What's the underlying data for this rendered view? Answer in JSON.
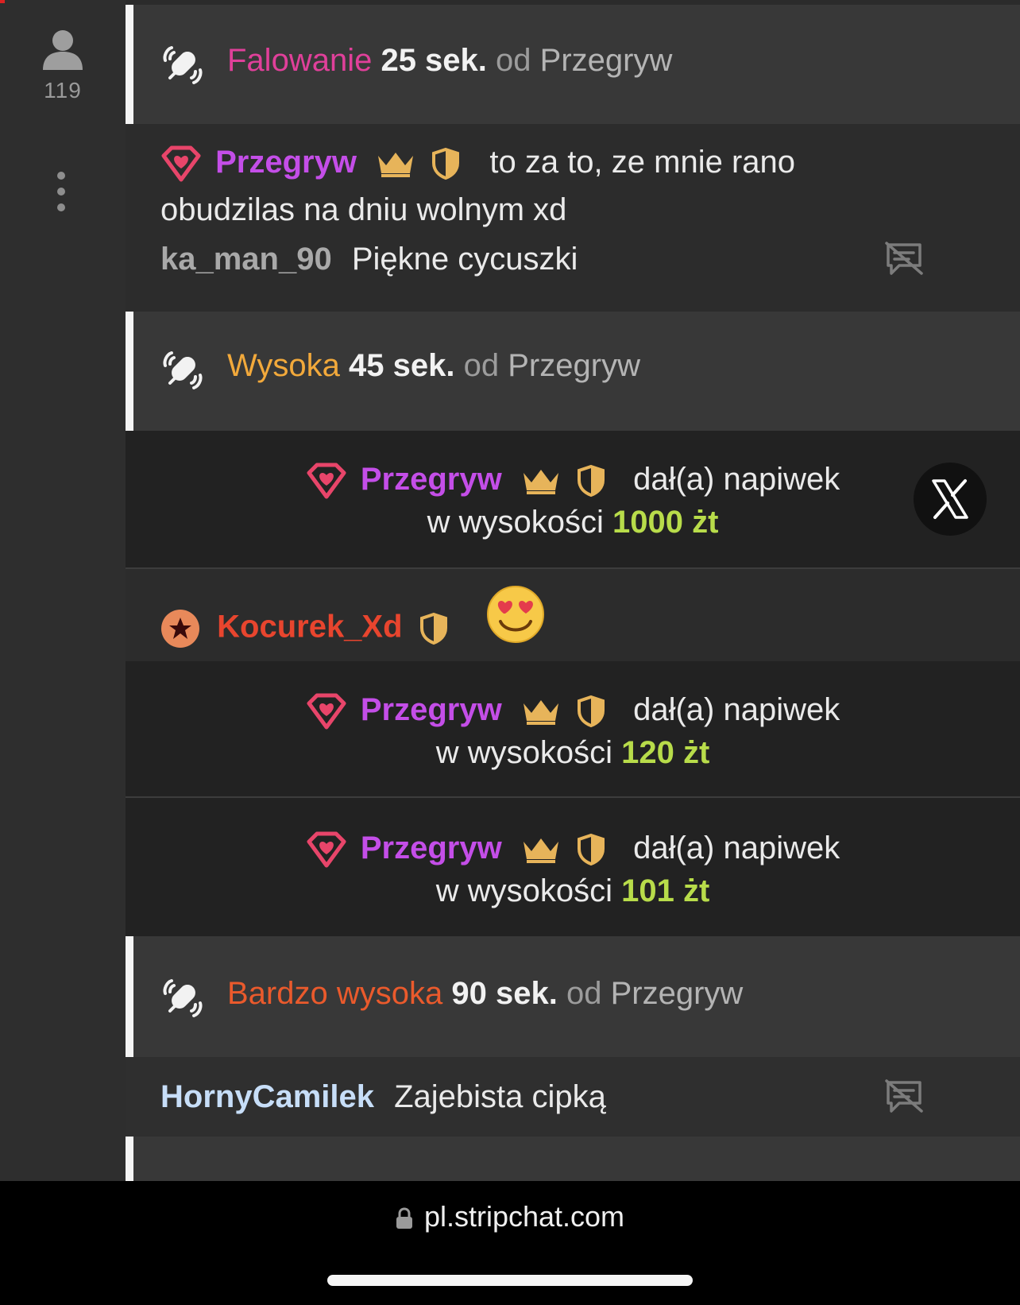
{
  "sidebar": {
    "viewer_count": "119",
    "icons": [
      "user-icon",
      "more-vertical-icon"
    ]
  },
  "vibrations": [
    {
      "level": "Falowanie",
      "level_color": "#e0409a",
      "duration": "25 sek.",
      "from_word": "od",
      "from_user": "Przegryw"
    },
    {
      "level": "Wysoka",
      "level_color": "#f2a93b",
      "duration": "45 sek.",
      "from_word": "od",
      "from_user": "Przegryw"
    },
    {
      "level": "Bardzo wysoka",
      "level_color": "#ea5a2c",
      "duration": "90 sek.",
      "from_word": "od",
      "from_user": "Przegryw"
    }
  ],
  "messages": {
    "przegryw_msg": {
      "user": "Przegryw",
      "text_line1": "to za to, ze mnie rano",
      "text_line2": "obudzilas na dniu wolnym xd"
    },
    "kaman": {
      "user": "ka_man_90",
      "text": "Piękne cycuszki"
    },
    "kocurek": {
      "user": "Kocurek_Xd"
    },
    "horny": {
      "user": "HornyCamilek",
      "text": "Zajebista cipką"
    }
  },
  "tips": [
    {
      "user": "Przegryw",
      "action": "dał(a) napiwek",
      "prefix": "w wysokości",
      "amount": "1000 żt"
    },
    {
      "user": "Przegryw",
      "action": "dał(a) napiwek",
      "prefix": "w wysokości",
      "amount": "120 żt"
    },
    {
      "user": "Przegryw",
      "action": "dał(a) napiwek",
      "prefix": "w wysokości",
      "amount": "101 żt"
    }
  ],
  "browser": {
    "url": "pl.stripchat.com"
  },
  "colors": {
    "accent_bar": "#f5f5f5",
    "tip_amount": "#b8dc4a",
    "username_purple": "#c44ee8"
  }
}
